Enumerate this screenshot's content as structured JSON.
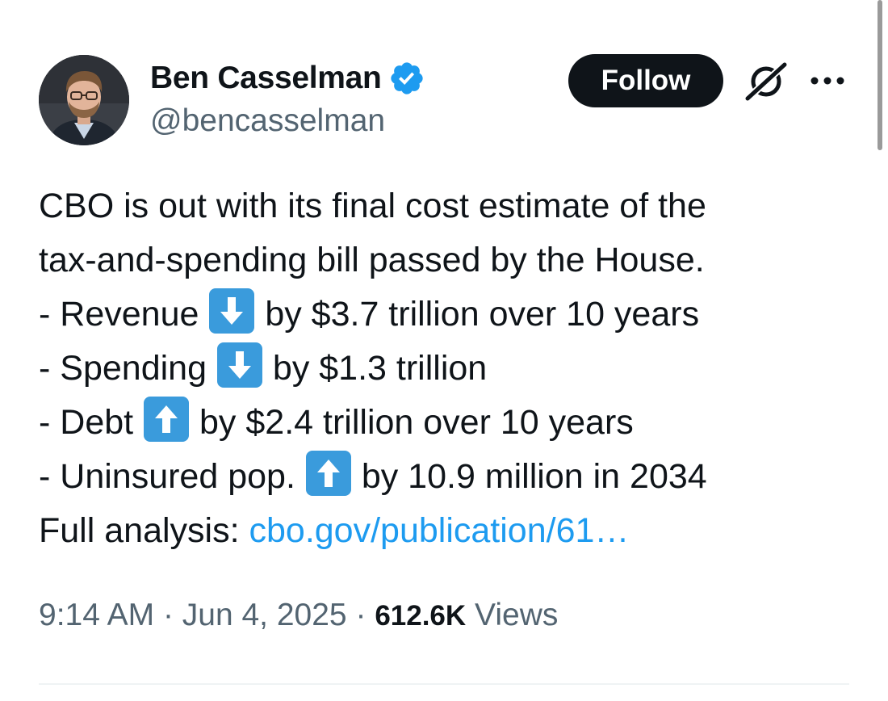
{
  "author": {
    "display_name": "Ben Casselman",
    "handle": "@bencasselman",
    "verified": true,
    "verified_color": "#1d9bf0",
    "avatar_icon": "profile-photo"
  },
  "actions": {
    "follow_label": "Follow",
    "grok_icon": "grok-icon",
    "more_icon": "more-horizontal-icon"
  },
  "tweet": {
    "line1": "CBO is out with its final cost estimate of the",
    "line2": "tax-and-spending bill passed by the House.",
    "bullets": [
      {
        "prefix": "- Revenue",
        "arrow": "down-arrow",
        "suffix": "by $3.7 trillion over 10 years"
      },
      {
        "prefix": "- Spending",
        "arrow": "down-arrow",
        "suffix": "by $1.3 trillion"
      },
      {
        "prefix": "- Debt",
        "arrow": "up-arrow",
        "suffix": "by $2.4 trillion over 10 years"
      },
      {
        "prefix": "- Uninsured pop.",
        "arrow": "up-arrow",
        "suffix": "by 10.9 million in 2034"
      }
    ],
    "analysis_label": "Full analysis:",
    "analysis_link": "cbo.gov/publication/61…",
    "link_color": "#1d9bf0"
  },
  "meta": {
    "time": "9:14 AM",
    "separator": "·",
    "date": "Jun 4, 2025",
    "views_count": "612.6K",
    "views_label": "Views"
  }
}
